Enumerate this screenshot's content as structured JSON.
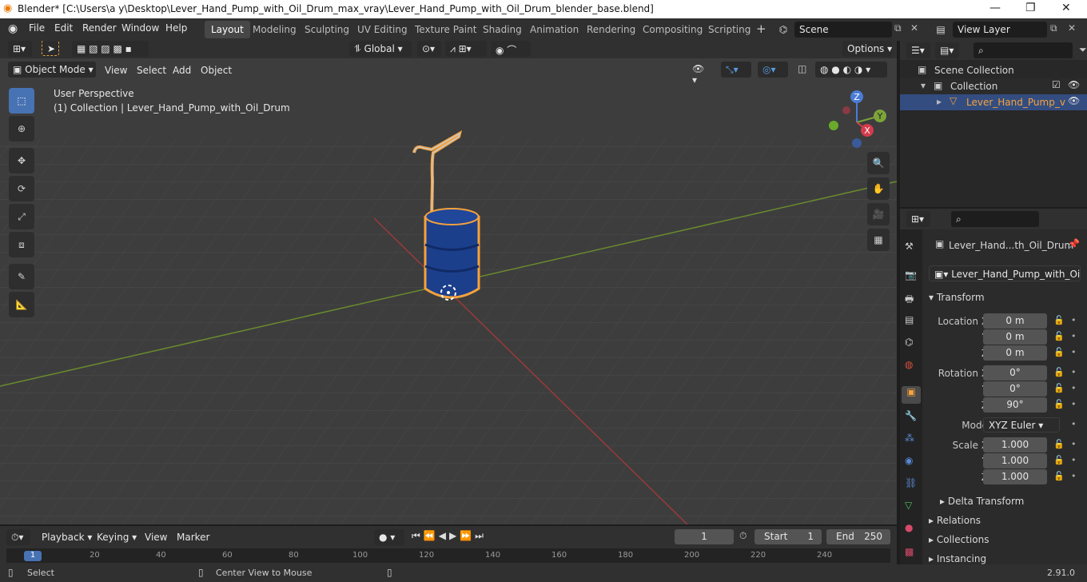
{
  "window": {
    "title": "Blender* [C:\\Users\\a y\\Desktop\\Lever_Hand_Pump_with_Oil_Drum_max_vray\\Lever_Hand_Pump_with_Oil_Drum_blender_base.blend]",
    "minimize": "—",
    "maximize": "❐",
    "close": "✕"
  },
  "menu": [
    "File",
    "Edit",
    "Render",
    "Window",
    "Help"
  ],
  "workspaces": [
    "Layout",
    "Modeling",
    "Sculpting",
    "UV Editing",
    "Texture Paint",
    "Shading",
    "Animation",
    "Rendering",
    "Compositing",
    "Scripting"
  ],
  "scene": {
    "name": "Scene"
  },
  "view_layer": {
    "name": "View Layer"
  },
  "toolbar": {
    "transform_orientation": "Global",
    "options": "Options"
  },
  "header": {
    "mode": "Object Mode",
    "view": "View",
    "select": "Select",
    "add": "Add",
    "object": "Object"
  },
  "viewport": {
    "perspective": "User Perspective",
    "collection_info": "(1) Collection | Lever_Hand_Pump_with_Oil_Drum"
  },
  "gizmo": {
    "x": "X",
    "y": "Y",
    "z": "Z"
  },
  "outliner": {
    "scene_collection": "Scene Collection",
    "collection": "Collection",
    "object": "Lever_Hand_Pump_v"
  },
  "properties": {
    "object_name": "Lever_Hand...th_Oil_Drum",
    "data_name": "Lever_Hand_Pump_with_Oil...",
    "transform": "Transform",
    "location_x_label": "Location X",
    "location_x": "0 m",
    "location_y": "0 m",
    "location_z": "0 m",
    "rotation_x_label": "Rotation X",
    "rotation_x": "0°",
    "rotation_y": "0°",
    "rotation_z": "90°",
    "mode_label": "Mode",
    "mode": "XYZ Euler",
    "scale_x_label": "Scale X",
    "scale_x": "1.000",
    "scale_y": "1.000",
    "scale_z": "1.000",
    "y_label": "Y",
    "z_label": "Z",
    "delta_transform": "Delta Transform",
    "relations": "Relations",
    "collections": "Collections",
    "instancing": "Instancing"
  },
  "timeline": {
    "playback": "Playback",
    "keying": "Keying",
    "view": "View",
    "marker": "Marker",
    "current_frame": "1",
    "start_label": "Start",
    "start": "1",
    "end_label": "End",
    "end": "250",
    "ticks": [
      "1",
      "20",
      "40",
      "60",
      "80",
      "100",
      "120",
      "140",
      "160",
      "180",
      "200",
      "220",
      "240"
    ]
  },
  "statusbar": {
    "select": "Select",
    "center_view": "Center View to Mouse",
    "version": "2.91.0"
  },
  "colors": {
    "accent": "#4772b3",
    "selection": "#f5a23c",
    "drum": "#1c3f8c"
  }
}
